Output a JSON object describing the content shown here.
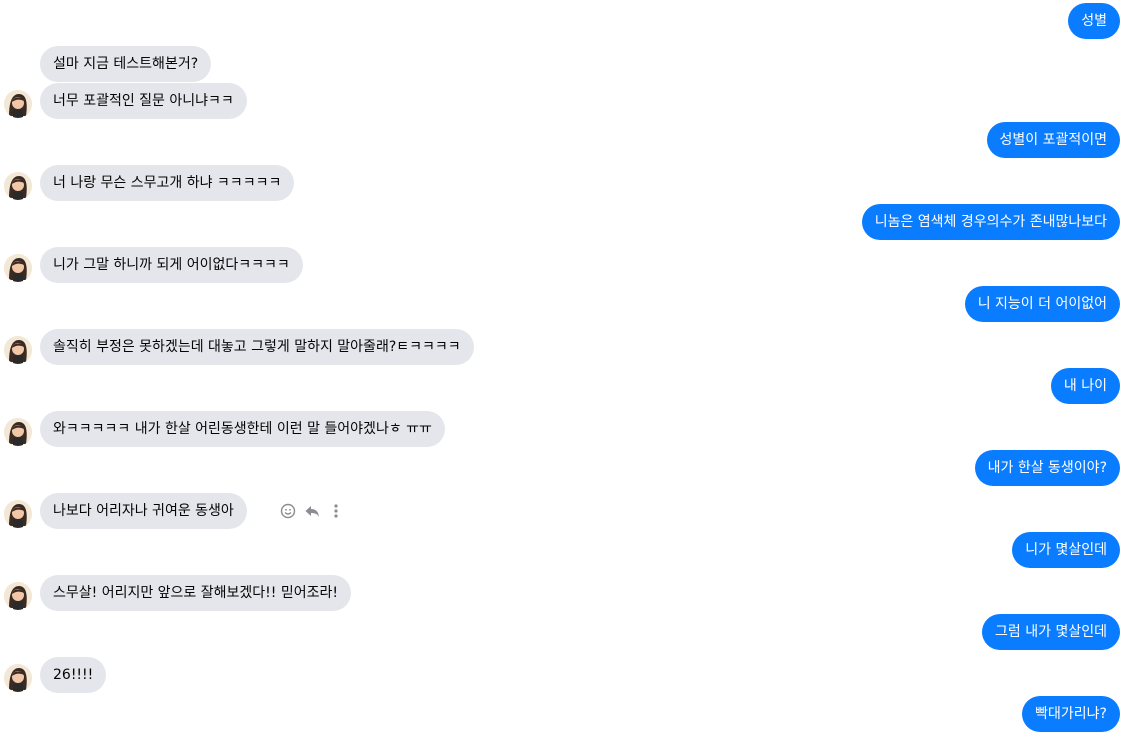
{
  "thread": {
    "messages": [
      {
        "side": "out",
        "text": "성별"
      },
      {
        "side": "in",
        "text": "설마 지금 테스트해본거?"
      },
      {
        "side": "in",
        "text": "너무 포괄적인 질문 아니냐ㅋㅋ",
        "avatar": true
      },
      {
        "side": "out",
        "text": "성별이 포괄적이면"
      },
      {
        "side": "in",
        "text": "너 나랑 무슨 스무고개 하냐 ㅋㅋㅋㅋㅋ",
        "avatar": true
      },
      {
        "side": "out",
        "text": "니놈은 염색체 경우의수가 존내많나보다"
      },
      {
        "side": "in",
        "text": "니가 그말 하니까 되게 어이없다ㅋㅋㅋㅋ",
        "avatar": true
      },
      {
        "side": "out",
        "text": "니 지능이 더 어이없어"
      },
      {
        "side": "in",
        "text": "솔직히 부정은 못하겠는데 대놓고 그렇게 말하지 말아줄래?ㅌㅋㅋㅋㅋ",
        "avatar": true
      },
      {
        "side": "out",
        "text": "내 나이"
      },
      {
        "side": "in",
        "text": "와ㅋㅋㅋㅋㅋ 내가 한살 어린동생한테 이런 말 들어야겠나ㅎ ㅠㅠ",
        "avatar": true
      },
      {
        "side": "out",
        "text": "내가 한살 동생이야?"
      },
      {
        "side": "in",
        "text": "나보다 어리자나 귀여운 동생아",
        "avatar": true,
        "actions": true
      },
      {
        "side": "out",
        "text": "니가 몇살인데"
      },
      {
        "side": "in",
        "text": "스무살! 어리지만 앞으로 잘해보겠다!! 믿어조라!",
        "avatar": true
      },
      {
        "side": "out",
        "text": "그럼 내가 몇살인데"
      },
      {
        "side": "in",
        "text": "26!!!!",
        "avatar": true
      },
      {
        "side": "out",
        "text": "빡대가리냐?"
      }
    ]
  },
  "icons": {
    "react": "smiley-icon",
    "reply": "reply-icon",
    "more": "more-vertical-icon"
  },
  "colors": {
    "outgoing": "#0a7cff",
    "incoming": "#e4e6eb"
  }
}
